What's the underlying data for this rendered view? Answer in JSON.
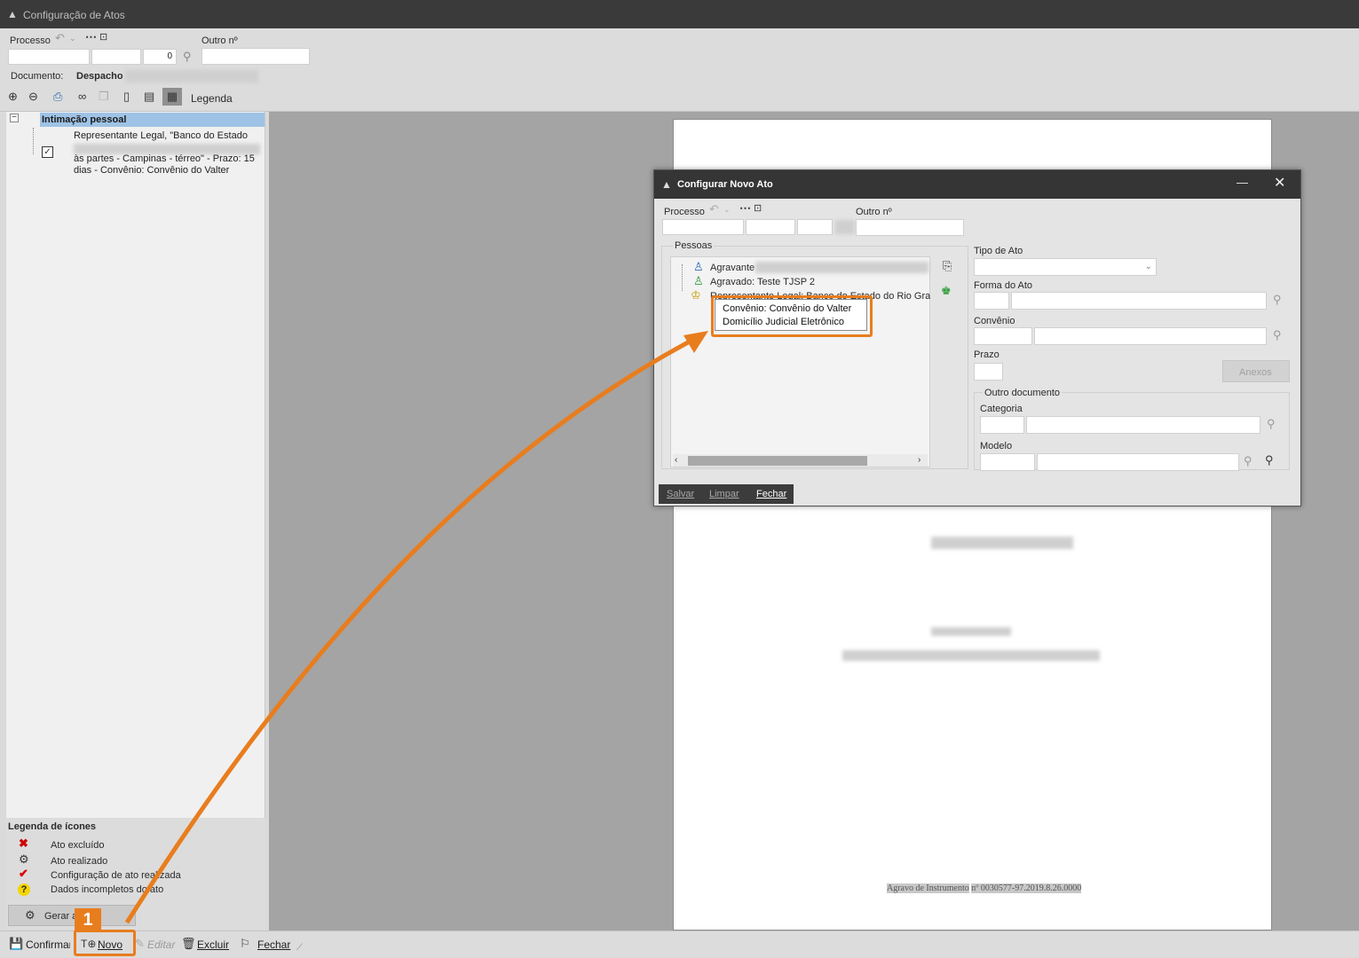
{
  "window": {
    "title": "Configuração de Atos"
  },
  "top": {
    "processo_label": "Processo",
    "processo_suffix": "0",
    "outro_label": "Outro nº",
    "documento_label": "Documento:",
    "documento_value": "Despacho",
    "toolbar": {
      "legenda_label": "Legenda"
    }
  },
  "tree": {
    "root": "Intimação pessoal",
    "item_line1": "Representante Legal, \"Banco do Estado",
    "item_line2": "às partes - Campinas - térreo\" - Prazo: 15",
    "item_line3": "dias - Convênio: Convênio do Valter"
  },
  "legend": {
    "title": "Legenda de ícones",
    "items": [
      {
        "icon": "red-x-icon",
        "label": "Ato excluído"
      },
      {
        "icon": "gear-icon",
        "label": "Ato realizado"
      },
      {
        "icon": "red-check-icon",
        "label": "Configuração de ato realizada"
      },
      {
        "icon": "yellow-question-icon",
        "label": "Dados incompletos do ato"
      }
    ],
    "gerar_label": "Gerar agora"
  },
  "bottom": {
    "confirmar": "Confirmar",
    "novo": "Novo",
    "editar": "Editar",
    "excluir": "Excluir",
    "fechar": "Fechar"
  },
  "document": {
    "footer_prefix": "Agravo de Instrumento",
    "footer_number": "nº 0030577-97.2019.8.26.0000"
  },
  "dialog": {
    "title": "Configurar Novo Ato",
    "processo_label": "Processo",
    "outro_label": "Outro nº",
    "pessoas_label": "Pessoas",
    "pessoas": [
      {
        "label": "Agravante"
      },
      {
        "label": "Agravado: Teste TJSP 2"
      },
      {
        "label": "Representante Legal: Banco do Estado do Rio Grande do Sul"
      }
    ],
    "tooltip_line1": "Convênio: Convênio do Valter",
    "tooltip_line2": "Domicílio Judicial Eletrônico",
    "tipo_label": "Tipo de Ato",
    "forma_label": "Forma do Ato",
    "convenio_label": "Convênio",
    "prazo_label": "Prazo",
    "anexos_label": "Anexos",
    "outro_doc_label": "Outro documento",
    "categoria_label": "Categoria",
    "modelo_label": "Modelo",
    "salvar": "Salvar",
    "limpar": "Limpar",
    "fechar": "Fechar"
  },
  "annotation": {
    "step": "1",
    "color": "#e87d1e"
  }
}
